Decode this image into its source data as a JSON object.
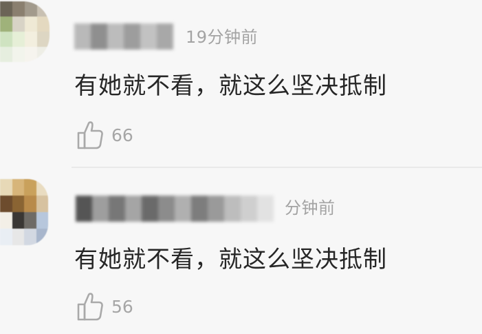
{
  "comments": [
    {
      "time": "19分钟前",
      "text": "有她就不看，就这么坚决抵制",
      "likes": "66",
      "avatar_colors": [
        "#6b6456",
        "#8a7f6f",
        "#a29a8c",
        "#c8c0b2",
        "#9fb27a",
        "#d8d3c6",
        "#efe9d5",
        "#e4d9c0",
        "#cfe3c1",
        "#e6efd7",
        "#f3efdf",
        "#ddd6c3",
        "#e6eedf",
        "#f2f4ec",
        "#f6f4ee",
        "#eeeee6"
      ],
      "username_colors": [
        "#b9b9b9",
        "#8f8f8f",
        "#bcbcbc",
        "#9d9d9d",
        "#c2c2c2",
        "#a8a8a8"
      ]
    },
    {
      "time": "分钟前",
      "text": "有她就不看，就这么坚决抵制",
      "likes": "56",
      "avatar_colors": [
        "#e7d9b7",
        "#d7b57a",
        "#c9a15c",
        "#e9dcc1",
        "#6d4c2d",
        "#8a6433",
        "#b88a4a",
        "#d7c2a0",
        "#f3efe7",
        "#3a3734",
        "#6e6b66",
        "#b7c7dc",
        "#e9eef4",
        "#e7e7e7",
        "#d2d8e2",
        "#a8b6cc"
      ],
      "username_colors": [
        "#555555",
        "#9e9e9e",
        "#777777",
        "#a5a5a5",
        "#6a6a6a",
        "#8c8c8c",
        "#b0b0b0",
        "#7d7d7d",
        "#9a9a9a",
        "#bdbdbd",
        "#cfcfcf",
        "#e2e2e2"
      ]
    }
  ],
  "like_icon": "thumbs-up-outline-icon"
}
